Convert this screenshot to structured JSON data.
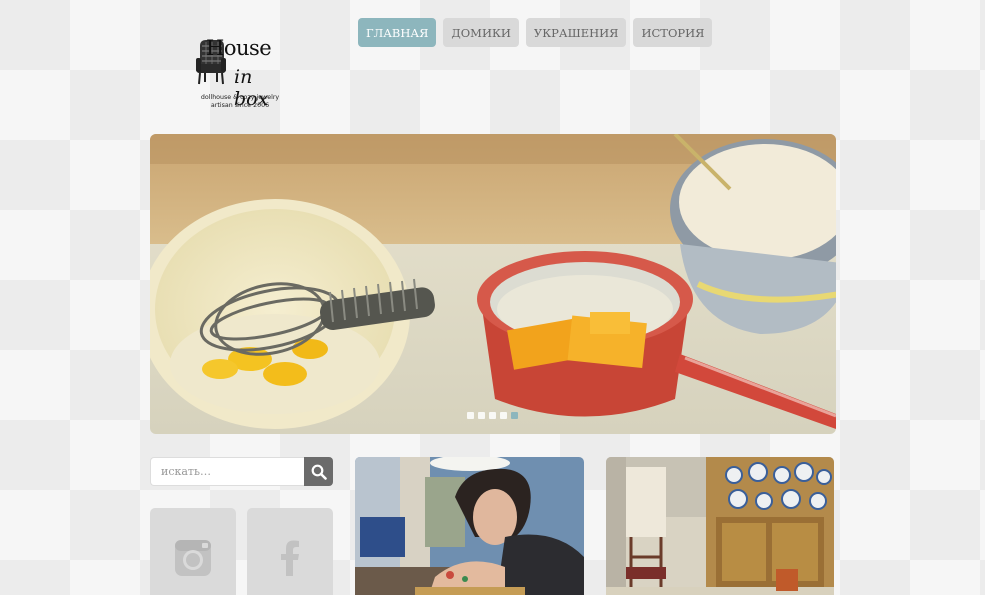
{
  "logo": {
    "line1": "House",
    "line2": "in box",
    "tagline1": "dollhouse & cozy jewelry",
    "tagline2": "artisan since 2006"
  },
  "nav": {
    "items": [
      {
        "label": "ГЛАВНАЯ",
        "active": true
      },
      {
        "label": "ДОМИКИ",
        "active": false
      },
      {
        "label": "УКРАШЕНИЯ",
        "active": false
      },
      {
        "label": "ИСТОРИЯ",
        "active": false
      }
    ]
  },
  "slider": {
    "slide_count": 5,
    "active_index": 4
  },
  "search": {
    "placeholder": "искать…",
    "button_icon": "search-icon"
  },
  "social": {
    "items": [
      {
        "network": "instagram",
        "icon": "instagram-icon"
      },
      {
        "network": "facebook",
        "icon": "facebook-icon"
      }
    ]
  },
  "colors": {
    "accent": "#8db6bd",
    "nav_inactive": "#d9d9d9",
    "search_button": "#6b6b6b",
    "social_tile": "#dadada"
  }
}
